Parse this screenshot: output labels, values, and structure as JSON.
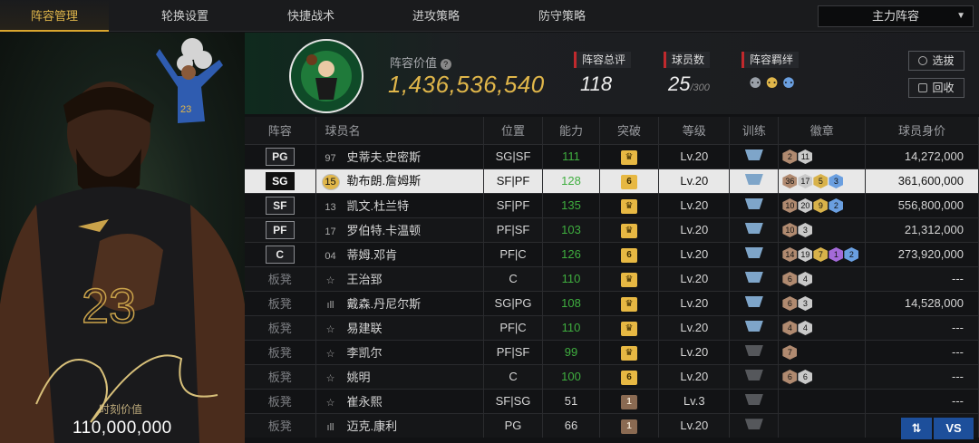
{
  "nav": {
    "tabs": [
      {
        "label": "阵容管理",
        "active": true
      },
      {
        "label": "轮换设置"
      },
      {
        "label": "快捷战术"
      },
      {
        "label": "进攻策略"
      },
      {
        "label": "防守策略"
      }
    ],
    "lineup_select": "主力阵容"
  },
  "hero": {
    "value_label": "时刻价值",
    "value": "110,000,000"
  },
  "team": {
    "value_label": "阵容价值",
    "value": "1,436,536,540",
    "rating_label": "阵容总评",
    "rating": "118",
    "players_label": "球员数",
    "players": "25",
    "players_max": "/300",
    "chem_label": "阵容羁绊",
    "draft_button": "选拔",
    "recycle_button": "回收"
  },
  "table": {
    "headers": [
      "阵容",
      "球员名",
      "位置",
      "能力",
      "突破",
      "等级",
      "训练",
      "徽章",
      "球员身价"
    ],
    "rows": [
      {
        "slot": "PG",
        "num": "97",
        "name": "史蒂夫.史密斯",
        "pos": "SG|SF",
        "ovr": "111",
        "brk": "♛",
        "lv": "Lv.20",
        "train": "blue",
        "badges": [
          [
            "b-br",
            "2"
          ],
          [
            "b-sv",
            "11"
          ]
        ],
        "value": "14,272,000"
      },
      {
        "slot": "SG",
        "num": "15",
        "name": "勒布朗.詹姆斯",
        "pos": "SF|PF",
        "ovr": "128",
        "brk": "6",
        "lv": "Lv.20",
        "train": "blue",
        "badges": [
          [
            "b-br",
            "36"
          ],
          [
            "b-sv",
            "17"
          ],
          [
            "b-gd",
            "5"
          ],
          [
            "b-bl",
            "3"
          ]
        ],
        "value": "361,600,000",
        "selected": true
      },
      {
        "slot": "SF",
        "num": "13",
        "name": "凯文.杜兰特",
        "pos": "SF|PF",
        "ovr": "135",
        "brk": "♛",
        "lv": "Lv.20",
        "train": "blue",
        "badges": [
          [
            "b-br",
            "10"
          ],
          [
            "b-sv",
            "20"
          ],
          [
            "b-gd",
            "9"
          ],
          [
            "b-bl",
            "2"
          ]
        ],
        "value": "556,800,000"
      },
      {
        "slot": "PF",
        "num": "17",
        "name": "罗伯特.卡温顿",
        "pos": "PF|SF",
        "ovr": "103",
        "brk": "♛",
        "lv": "Lv.20",
        "train": "blue",
        "badges": [
          [
            "b-br",
            "10"
          ],
          [
            "b-sv",
            "3"
          ]
        ],
        "value": "21,312,000"
      },
      {
        "slot": "C",
        "num": "04",
        "name": "蒂姆.邓肯",
        "pos": "PF|C",
        "ovr": "126",
        "brk": "6",
        "lv": "Lv.20",
        "train": "blue",
        "badges": [
          [
            "b-br",
            "14"
          ],
          [
            "b-sv",
            "19"
          ],
          [
            "b-gd",
            "7"
          ],
          [
            "b-pu",
            "1"
          ],
          [
            "b-bl",
            "2"
          ]
        ],
        "value": "273,920,000"
      },
      {
        "slot": "板凳",
        "num": "☆",
        "name": "王治郅",
        "pos": "C",
        "ovr": "110",
        "brk": "♛",
        "lv": "Lv.20",
        "train": "blue",
        "badges": [
          [
            "b-br",
            "6"
          ],
          [
            "b-sv",
            "4"
          ]
        ],
        "value": "---"
      },
      {
        "slot": "板凳",
        "num": "ıll",
        "name": "戴森.丹尼尔斯",
        "pos": "SG|PG",
        "ovr": "108",
        "brk": "♛",
        "lv": "Lv.20",
        "train": "blue",
        "badges": [
          [
            "b-br",
            "6"
          ],
          [
            "b-sv",
            "3"
          ]
        ],
        "value": "14,528,000"
      },
      {
        "slot": "板凳",
        "num": "☆",
        "name": "易建联",
        "pos": "PF|C",
        "ovr": "110",
        "brk": "♛",
        "lv": "Lv.20",
        "train": "blue",
        "badges": [
          [
            "b-br",
            "4"
          ],
          [
            "b-sv",
            "4"
          ]
        ],
        "value": "---"
      },
      {
        "slot": "板凳",
        "num": "☆",
        "name": "李凯尔",
        "pos": "PF|SF",
        "ovr": "99",
        "brk": "♛",
        "lv": "Lv.20",
        "train": "grey",
        "badges": [
          [
            "b-br",
            "7"
          ]
        ],
        "value": "---"
      },
      {
        "slot": "板凳",
        "num": "☆",
        "name": "姚明",
        "pos": "C",
        "ovr": "100",
        "brk": "6",
        "lv": "Lv.20",
        "train": "grey",
        "badges": [
          [
            "b-br",
            "6"
          ],
          [
            "b-sv",
            "6"
          ]
        ],
        "value": "---"
      },
      {
        "slot": "板凳",
        "num": "☆",
        "name": "崔永熙",
        "pos": "SF|SG",
        "ovr": "51",
        "brk": "1",
        "lv": "Lv.3",
        "train": "grey",
        "badges": [],
        "value": "---",
        "plain": true,
        "brown": true
      },
      {
        "slot": "板凳",
        "num": "ıll",
        "name": "迈克.康利",
        "pos": "PG",
        "ovr": "66",
        "brk": "1",
        "lv": "Lv.20",
        "train": "grey",
        "badges": [],
        "value": "",
        "plain": true,
        "brown": true
      }
    ]
  },
  "vs": {
    "swap": "⇅",
    "label": "VS"
  },
  "colors": {
    "accent": "#e0b64a",
    "green": "#3fae3f",
    "selected_row": "#e8e8e8",
    "brand_red": "#c0292d"
  }
}
